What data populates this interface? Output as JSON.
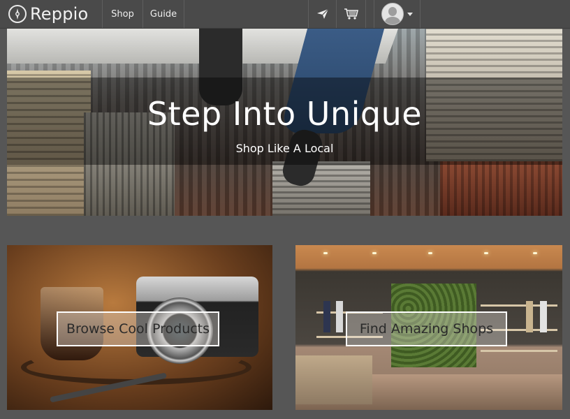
{
  "brand": {
    "name": "Reppio"
  },
  "nav": {
    "links": [
      "Shop",
      "Guide"
    ],
    "icons": [
      "send-icon",
      "cart-icon",
      "user-avatar",
      "chevron-down-icon"
    ]
  },
  "hero": {
    "title": "Step Into Unique",
    "subtitle": "Shop Like A Local"
  },
  "tiles": [
    {
      "label": "Browse Cool Products"
    },
    {
      "label": "Find Amazing Shops"
    }
  ],
  "colors": {
    "nav_bg": "#4a4a4a",
    "page_bg": "#565656",
    "text_light": "#ffffff"
  }
}
